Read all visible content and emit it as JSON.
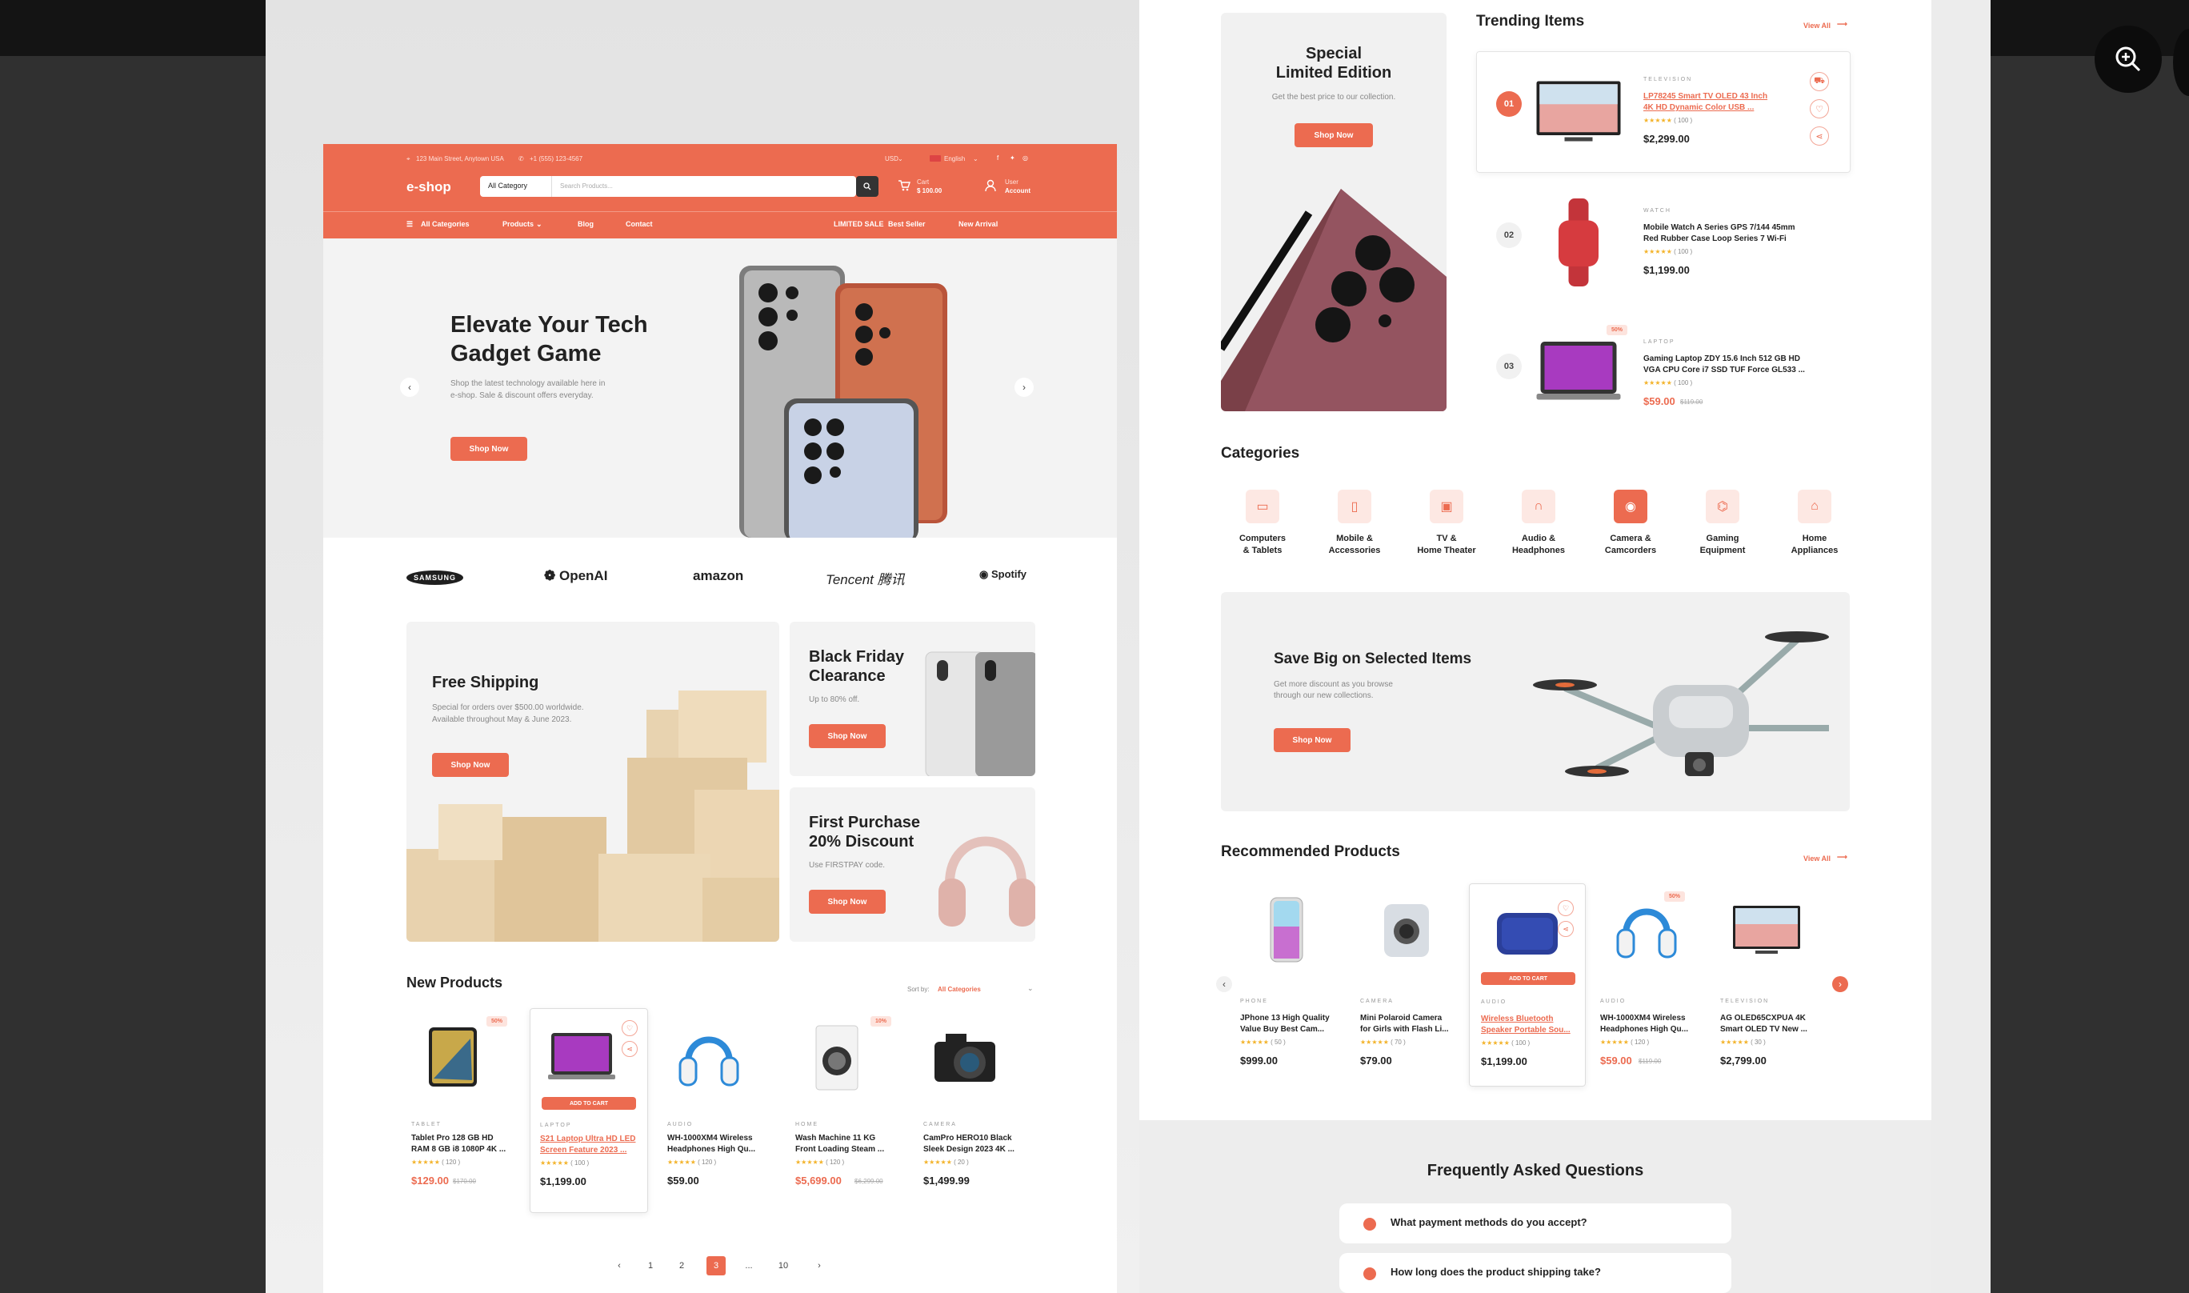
{
  "viewer": {
    "zoom_icon": "zoom-in-icon"
  },
  "left": {
    "topbar": {
      "address": "123 Main Street, Anytown USA",
      "phone": "+1 (555) 123-4567",
      "currency": "USD",
      "language": "English"
    },
    "header": {
      "logo": "e-shop",
      "category_select": "All Category",
      "search_placeholder": "Search Products...",
      "cart_label": "Cart",
      "cart_value": "$ 100.00",
      "account_label1": "User",
      "account_label2": "Account"
    },
    "nav": {
      "all_categories": "All Categories",
      "products": "Products",
      "blog": "Blog",
      "contact": "Contact",
      "limited_sale": "LIMITED SALE",
      "best_seller": "Best Seller",
      "new_arrival": "New Arrival"
    },
    "hero": {
      "title1": "Elevate Your Tech",
      "title2": "Gadget Game",
      "sub1": "Shop the latest technology available here in",
      "sub2": "e-shop. Sale & discount offers everyday.",
      "button": "Shop Now"
    },
    "brands": [
      "SAMSUNG",
      "OpenAI",
      "amazon",
      "Tencent 腾讯",
      "Spotify"
    ],
    "promos": {
      "shipping": {
        "title": "Free Shipping",
        "sub1": "Special for orders over $500.00 worldwide.",
        "sub2": "Available throughout May & June 2023.",
        "button": "Shop Now"
      },
      "black_friday": {
        "title1": "Black Friday",
        "title2": "Clearance",
        "sub": "Up to 80% off.",
        "button": "Shop Now"
      },
      "first_purchase": {
        "title1": "First Purchase",
        "title2": "20% Discount",
        "sub": "Use FIRSTPAY code.",
        "button": "Shop Now"
      }
    },
    "new_products": {
      "title": "New Products",
      "sort_label": "Sort by:",
      "sort_value": "All Categories",
      "items": [
        {
          "category": "TABLET",
          "name1": "Tablet Pro 128 GB HD",
          "name2": "RAM 8 GB i8 1080P 4K ...",
          "reviews": "( 120 )",
          "price": "$129.00",
          "old": "$170.00",
          "badge": "50%"
        },
        {
          "category": "LAPTOP",
          "name1": "S21 Laptop Ultra HD LED",
          "name2": "Screen Feature 2023 ...",
          "reviews": "( 100 )",
          "price": "$1,199.00",
          "cart": "ADD TO CART"
        },
        {
          "category": "AUDIO",
          "name1": "WH-1000XM4 Wireless",
          "name2": "Headphones High Qu...",
          "reviews": "( 120 )",
          "price": "$59.00"
        },
        {
          "category": "HOME",
          "name1": "Wash Machine 11 KG",
          "name2": "Front Loading Steam ...",
          "reviews": "( 120 )",
          "price": "$5,699.00",
          "old": "$6,299.00",
          "badge": "10%"
        },
        {
          "category": "CAMERA",
          "name1": "CamPro HERO10 Black",
          "name2": "Sleek Design 2023 4K ...",
          "reviews": "( 20 )",
          "price": "$1,499.99"
        }
      ]
    },
    "pagination": [
      "1",
      "2",
      "3",
      "...",
      "10"
    ]
  },
  "right": {
    "special": {
      "title1": "Special",
      "title2": "Limited Edition",
      "sub": "Get the best price to our collection.",
      "button": "Shop Now"
    },
    "trending": {
      "title": "Trending Items",
      "view_all": "View All",
      "items": [
        {
          "num": "01",
          "category": "TELEVISION",
          "name1": "LP78245 Smart TV OLED 43 Inch",
          "name2": "4K HD Dynamic Color USB ...",
          "reviews": "( 100 )",
          "price": "$2,299.00"
        },
        {
          "num": "02",
          "category": "WATCH",
          "name1": "Mobile Watch A Series GPS 7/144 45mm",
          "name2": "Red Rubber Case Loop Series 7 Wi-Fi",
          "reviews": "( 100 )",
          "price": "$1,199.00"
        },
        {
          "num": "03",
          "category": "LAPTOP",
          "name1": "Gaming Laptop ZDY 15.6 Inch 512 GB HD",
          "name2": "VGA CPU Core i7 SSD TUF Force GL533 ...",
          "reviews": "( 100 )",
          "price": "$59.00",
          "old": "$119.00",
          "badge": "50%"
        }
      ]
    },
    "categories": {
      "title": "Categories",
      "items": [
        {
          "l1": "Computers",
          "l2": "& Tablets",
          "icon": "monitor-icon"
        },
        {
          "l1": "Mobile &",
          "l2": "Accessories",
          "icon": "mobile-icon"
        },
        {
          "l1": "TV &",
          "l2": "Home Theater",
          "icon": "tv-icon"
        },
        {
          "l1": "Audio &",
          "l2": "Headphones",
          "icon": "headphones-icon"
        },
        {
          "l1": "Camera &",
          "l2": "Camcorders",
          "icon": "camera-icon"
        },
        {
          "l1": "Gaming",
          "l2": "Equipment",
          "icon": "gamepad-icon"
        },
        {
          "l1": "Home",
          "l2": "Appliances",
          "icon": "home-icon"
        }
      ]
    },
    "save_big": {
      "title": "Save Big on Selected Items",
      "sub1": "Get more discount as you browse",
      "sub2": "through our new collections.",
      "button": "Shop Now"
    },
    "recommended": {
      "title": "Recommended Products",
      "view_all": "View All",
      "items": [
        {
          "category": "PHONE",
          "name1": "JPhone 13 High Quality",
          "name2": "Value Buy Best Cam...",
          "reviews": "( 50 )",
          "price": "$999.00"
        },
        {
          "category": "CAMERA",
          "name1": "Mini Polaroid Camera",
          "name2": "for Girls with Flash Li...",
          "reviews": "( 70 )",
          "price": "$79.00"
        },
        {
          "category": "AUDIO",
          "name1": "Wireless Bluetooth",
          "name2": "Speaker Portable Sou...",
          "reviews": "( 100 )",
          "price": "$1,199.00",
          "cart": "ADD TO CART"
        },
        {
          "category": "AUDIO",
          "name1": "WH-1000XM4 Wireless",
          "name2": "Headphones High Qu...",
          "reviews": "( 120 )",
          "price": "$59.00",
          "old": "$119.00",
          "badge": "50%"
        },
        {
          "category": "TELEVISION",
          "name1": "AG OLED65CXPUA 4K",
          "name2": "Smart OLED TV New ...",
          "reviews": "( 30 )",
          "price": "$2,799.00"
        }
      ]
    },
    "faq": {
      "title": "Frequently Asked Questions",
      "q1": "What payment methods do you accept?",
      "q2": "How long does the product shipping take?"
    }
  },
  "colors": {
    "accent": "#ec6b50",
    "dark": "#222222"
  }
}
